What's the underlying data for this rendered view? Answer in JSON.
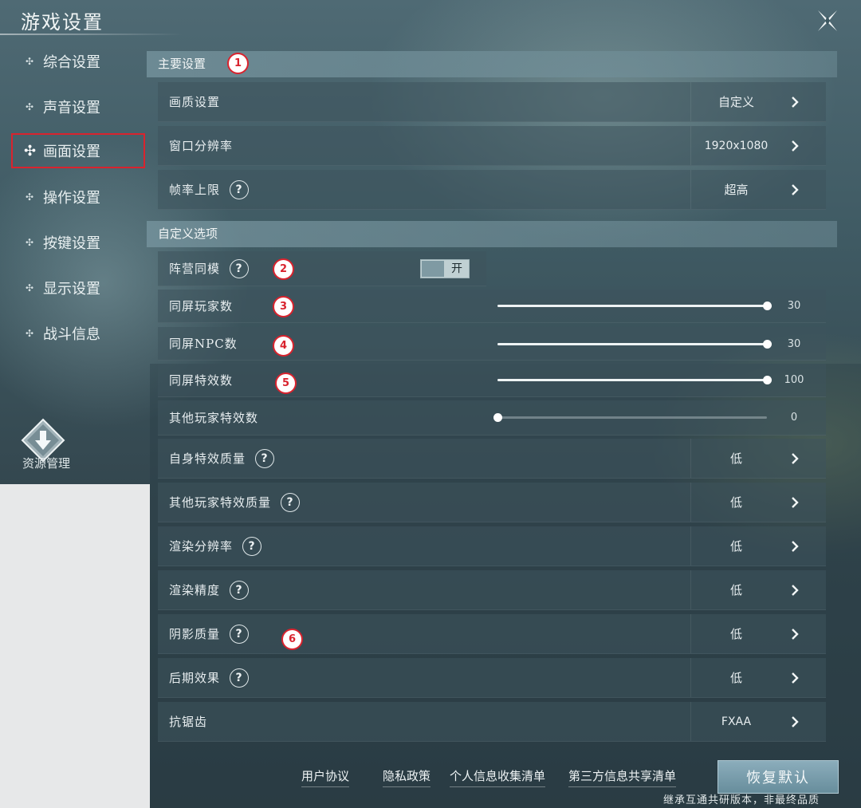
{
  "window": {
    "title": "游戏设置"
  },
  "sidebar": {
    "items": [
      {
        "label": "综合设置"
      },
      {
        "label": "声音设置"
      },
      {
        "label": "画面设置"
      },
      {
        "label": "操作设置"
      },
      {
        "label": "按键设置"
      },
      {
        "label": "显示设置"
      },
      {
        "label": "战斗信息"
      }
    ],
    "active_index": 2,
    "resource_label": "资源管理"
  },
  "main_section": {
    "header": "主要设置",
    "rows": [
      {
        "label": "画质设置",
        "value": "自定义"
      },
      {
        "label": "窗口分辨率",
        "value": "1920x1080"
      },
      {
        "label": "帧率上限",
        "value": "超高"
      }
    ]
  },
  "custom_section": {
    "header": "自定义选项",
    "toggle": {
      "label": "阵营同模",
      "value": "开",
      "on": true
    },
    "sliders": [
      {
        "label": "同屏玩家数",
        "value": "30",
        "fraction": 1.0
      },
      {
        "label": "同屏NPC数",
        "value": "30",
        "fraction": 1.0
      },
      {
        "label": "同屏特效数",
        "value": "100",
        "fraction": 1.0
      },
      {
        "label": "其他玩家特效数",
        "value": "0",
        "fraction": 0.0
      }
    ],
    "rows": [
      {
        "label": "自身特效质量",
        "value": "低"
      },
      {
        "label": "其他玩家特效质量",
        "value": "低"
      },
      {
        "label": "渲染分辨率",
        "value": "低"
      },
      {
        "label": "渲染精度",
        "value": "低"
      },
      {
        "label": "阴影质量",
        "value": "低"
      },
      {
        "label": "后期效果",
        "value": "低"
      },
      {
        "label": "抗锯齿",
        "value": "FXAA"
      }
    ]
  },
  "markers": [
    "1",
    "2",
    "3",
    "4",
    "5",
    "6"
  ],
  "footer": {
    "links": [
      "用户协议",
      "隐私政策",
      "个人信息收集清单",
      "第三方信息共享清单"
    ],
    "restore_button": "恢复默认",
    "note": "继承互通共研版本，非最终品质"
  },
  "colors": {
    "annotation_red": "#d9232e",
    "panel": "#3e545c"
  }
}
